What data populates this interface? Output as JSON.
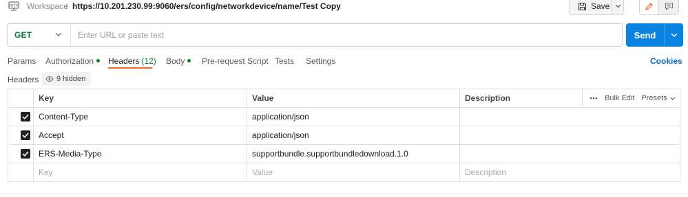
{
  "breadcrumb": {
    "workspace": "Workspace",
    "separator": "/",
    "request_path": "https://10.201.230.99:9060/ers/config/networkdevice/name/Test Copy"
  },
  "toolbar": {
    "save_label": "Save"
  },
  "request": {
    "method": "GET",
    "url_placeholder": "Enter URL or paste text",
    "send_label": "Send"
  },
  "tabs": [
    {
      "label": "Params"
    },
    {
      "label": "Authorization",
      "dot": true
    },
    {
      "label": "Headers",
      "count": "(12)",
      "active": true
    },
    {
      "label": "Body",
      "dot": true
    },
    {
      "label": "Pre-request Script"
    },
    {
      "label": "Tests"
    },
    {
      "label": "Settings"
    }
  ],
  "cookies_label": "Cookies",
  "headers_section": {
    "title": "Headers",
    "hidden_badge": "9 hidden"
  },
  "table": {
    "columns": {
      "key": "Key",
      "value": "Value",
      "description": "Description"
    },
    "bulk_edit": "Bulk Edit",
    "presets": "Presets",
    "rows": [
      {
        "checked": true,
        "key": "Content-Type",
        "value": "application/json",
        "description": ""
      },
      {
        "checked": true,
        "key": "Accept",
        "value": "application/json",
        "description": ""
      },
      {
        "checked": true,
        "key": "ERS-Media-Type",
        "value": "supportbundle.supportbundledownload.1.0",
        "description": ""
      }
    ],
    "placeholder_row": {
      "key": "Key",
      "value": "Value",
      "description": "Description"
    }
  },
  "colors": {
    "accent_blue": "#0a84e0",
    "method_green": "#0c7e33",
    "active_tab_underline": "#f06a2f",
    "cookies_blue": "#0a6fc2"
  },
  "icons": [
    "http-icon",
    "save-icon",
    "chevron-down-icon",
    "edit-icon",
    "comment-icon",
    "eye-icon",
    "more-icon",
    "checkbox-checked-icon"
  ]
}
